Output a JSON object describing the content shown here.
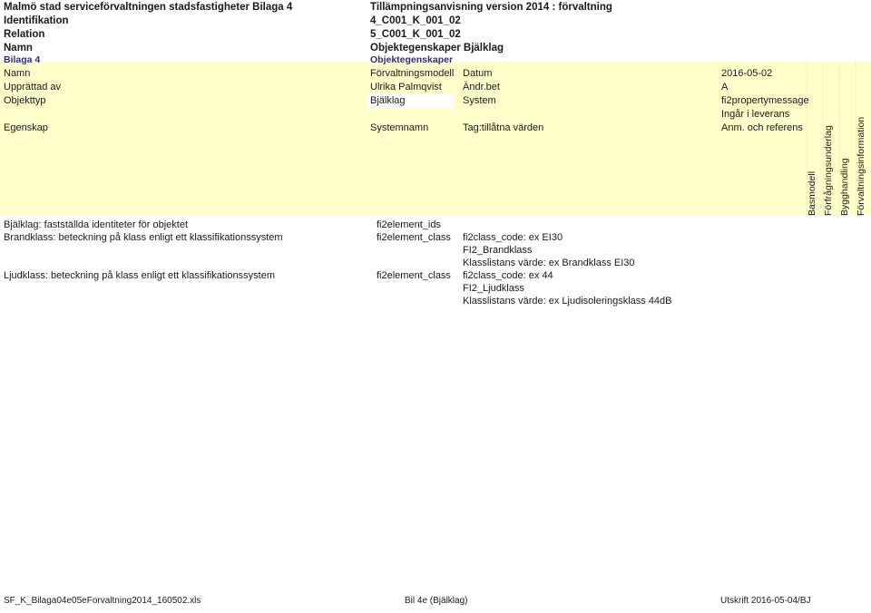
{
  "colors": {
    "band_yellow": "#ffffcc",
    "link_blue": "#31316a",
    "text": "#1a1a1a",
    "page_white": "#ffffff"
  },
  "header": {
    "org_title": "Malmö stad serviceförvaltningen stadsfastigheter Bilaga 4",
    "doc_title": "Tillämpningsanvisning version 2014 : förvaltning",
    "rows": [
      {
        "label": "Identifikation",
        "value": "4_C001_K_001_02"
      },
      {
        "label": "Relation",
        "value": "5_C001_K_001_02"
      },
      {
        "label": "Namn",
        "value": "Objektegenskaper Bjälklag"
      }
    ],
    "sub_label": "Bilaga 4",
    "sub_value": "Objektegenskaper"
  },
  "meta": {
    "rows": [
      {
        "label": "Namn",
        "value": "Förvaltningsmodell",
        "field": "Datum",
        "field_value": "2016-05-02"
      },
      {
        "label": "Upprättad av",
        "value": "Ulrika Palmqvist",
        "field": "Ändr.bet",
        "field_value": "A"
      },
      {
        "label": "Objekttyp",
        "value": "Bjälklag",
        "field": "System",
        "field_value": "fi2propertymessage"
      }
    ],
    "extra_value": "Ingår i leverans"
  },
  "table_headers": {
    "col_egenskap": "Egenskap",
    "col_systemnamn": "Systemnamn",
    "col_tag": "Tag:tillåtna värden",
    "col_anm": "Anm. och referens",
    "vertical": [
      "Basmodell",
      "Förfrågningsunderlag",
      "Bygghandling",
      "Förvaltningsinformation"
    ]
  },
  "table_rows": [
    {
      "egenskap": "Bjälklag: fastställda identiteter för objektet",
      "systemnamn": "fi2element_ids",
      "tag_lines": []
    },
    {
      "egenskap": "Brandklass: beteckning på klass enligt ett klassifikationssystem",
      "systemnamn": "fi2element_class",
      "tag_lines": [
        "fi2class_code: ex EI30",
        "FI2_Brandklass",
        "Klasslistans värde: ex Brandklass EI30"
      ]
    },
    {
      "egenskap": "Ljudklass: beteckning på klass enligt ett klassifikationssystem",
      "systemnamn": "fi2element_class",
      "tag_lines": [
        "fi2class_code: ex 44",
        "FI2_Ljudklass",
        "Klasslistans värde: ex Ljudisoleringsklass 44dB"
      ]
    }
  ],
  "footer": {
    "left": "SF_K_Bilaga04e05eForvaltning2014_160502.xls",
    "middle": "Bil 4e (Bjälklag)",
    "right": "Utskrift 2016-05-04/BJ"
  }
}
